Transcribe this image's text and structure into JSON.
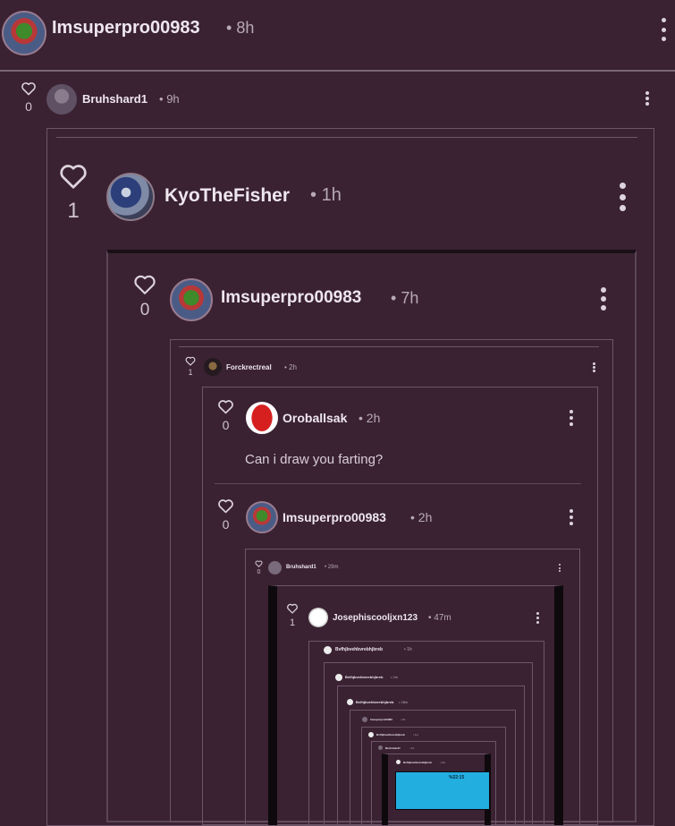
{
  "top": {
    "username": "Imsuperpro00983",
    "time": "8h"
  },
  "c1": {
    "username": "Bruhshard1",
    "time": "9h",
    "likes": "0"
  },
  "c2": {
    "username": "KyoTheFisher",
    "time": "1h",
    "likes": "1"
  },
  "c3": {
    "username": "Imsuperpro00983",
    "time": "7h",
    "likes": "0"
  },
  "c4": {
    "username": "Forckrectreal",
    "time": "2h",
    "likes": "1"
  },
  "c5": {
    "username": "Oroballsak",
    "time": "2h",
    "likes": "0",
    "text": "Can i draw you farting?"
  },
  "c6": {
    "username": "Imsuperpro00983",
    "time": "2h",
    "likes": "0"
  },
  "c7": {
    "username": "Bruhshard1",
    "time": "29m",
    "likes": "0"
  },
  "c8": {
    "username": "Josephiscooljxn123",
    "time": "47m",
    "likes": "1"
  },
  "c9": {
    "username": "Bvfhjbvehbvrebhjbreb",
    "time": "1h"
  },
  "c10": {
    "username": "Bvfhjbvehbvrebhjbreb",
    "time": "2m"
  },
  "c11": {
    "username": "Bvfhjbvehbvrebhjbreb",
    "time": "28m"
  },
  "c12": {
    "username": "Imsuperpro00983",
    "time": "2h"
  },
  "c13": {
    "username": "Bvfhjbvehbvrebhjbreb",
    "time": "1m"
  },
  "c14": {
    "username": "Bruhshard1",
    "time": "1h"
  },
  "c15": {
    "username": "Bvfhjbvehbvrebhjbreb",
    "time": "2m"
  },
  "screen": {
    "corner": "%22:15"
  },
  "separator": "•",
  "colors": {
    "background": "#3a2232",
    "text": "#e9e1e8",
    "muted": "#b8aab5",
    "frame": "#6c5668",
    "cyan": "#23aee0"
  },
  "icons": {
    "like": "heart-icon",
    "menu": "more-vertical-icon"
  }
}
